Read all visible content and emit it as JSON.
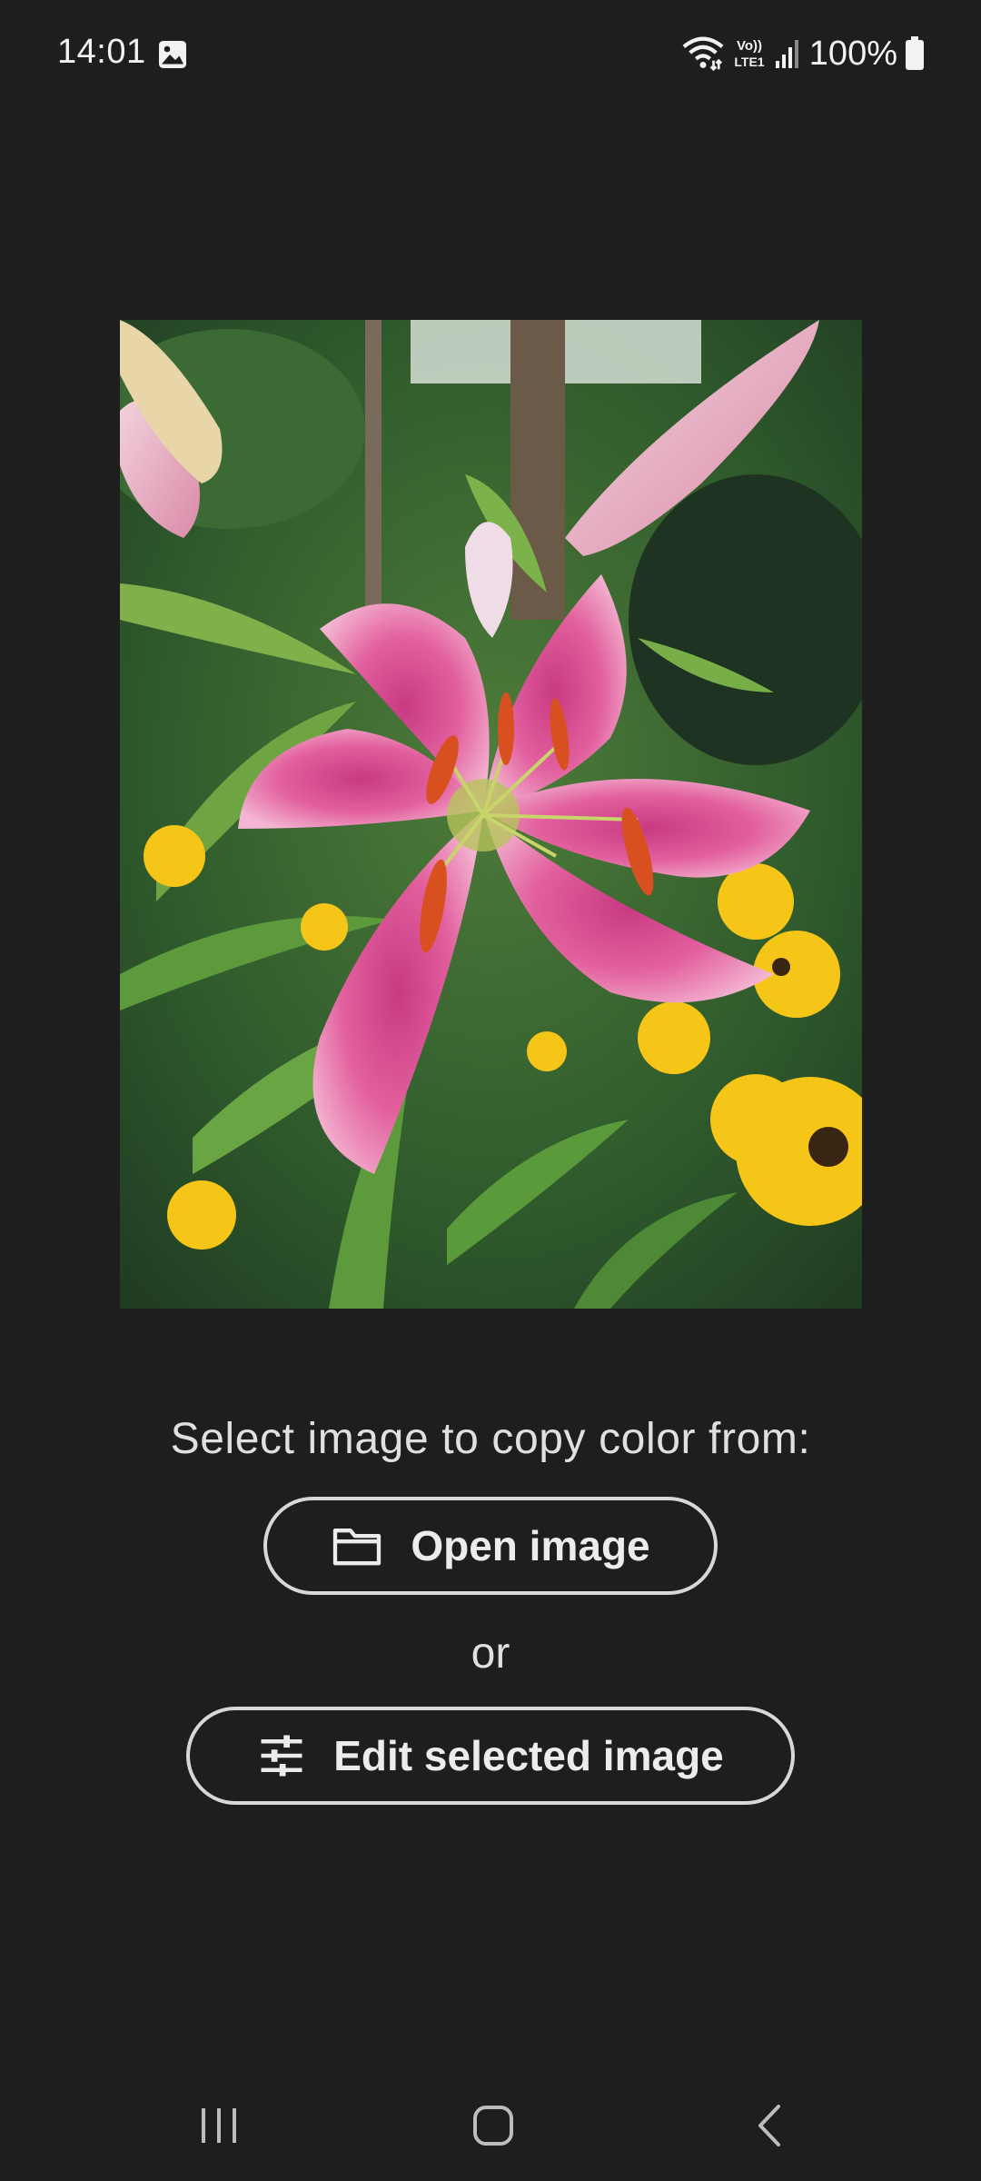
{
  "status_bar": {
    "time": "14:01",
    "battery_percent": "100%",
    "icons": [
      "gallery-icon",
      "wifi-icon",
      "volte-icon",
      "signal-icon",
      "battery-icon"
    ],
    "volte_label_top": "Vo))",
    "volte_label_bottom": "LTE1"
  },
  "preview": {
    "subject": "pink lily with yellow flowers"
  },
  "main": {
    "prompt": "Select image to copy color from:",
    "open_button_label": "Open image",
    "open_button_icon": "folder-icon",
    "or_label": "or",
    "edit_button_label": "Edit selected image",
    "edit_button_icon": "sliders-icon"
  },
  "nav_bar": {
    "icons": [
      "recent-apps-icon",
      "home-icon",
      "back-icon"
    ]
  },
  "colors": {
    "background": "#1e1e1e",
    "text": "#e0e0e0",
    "button_border": "#d8d8d8"
  }
}
